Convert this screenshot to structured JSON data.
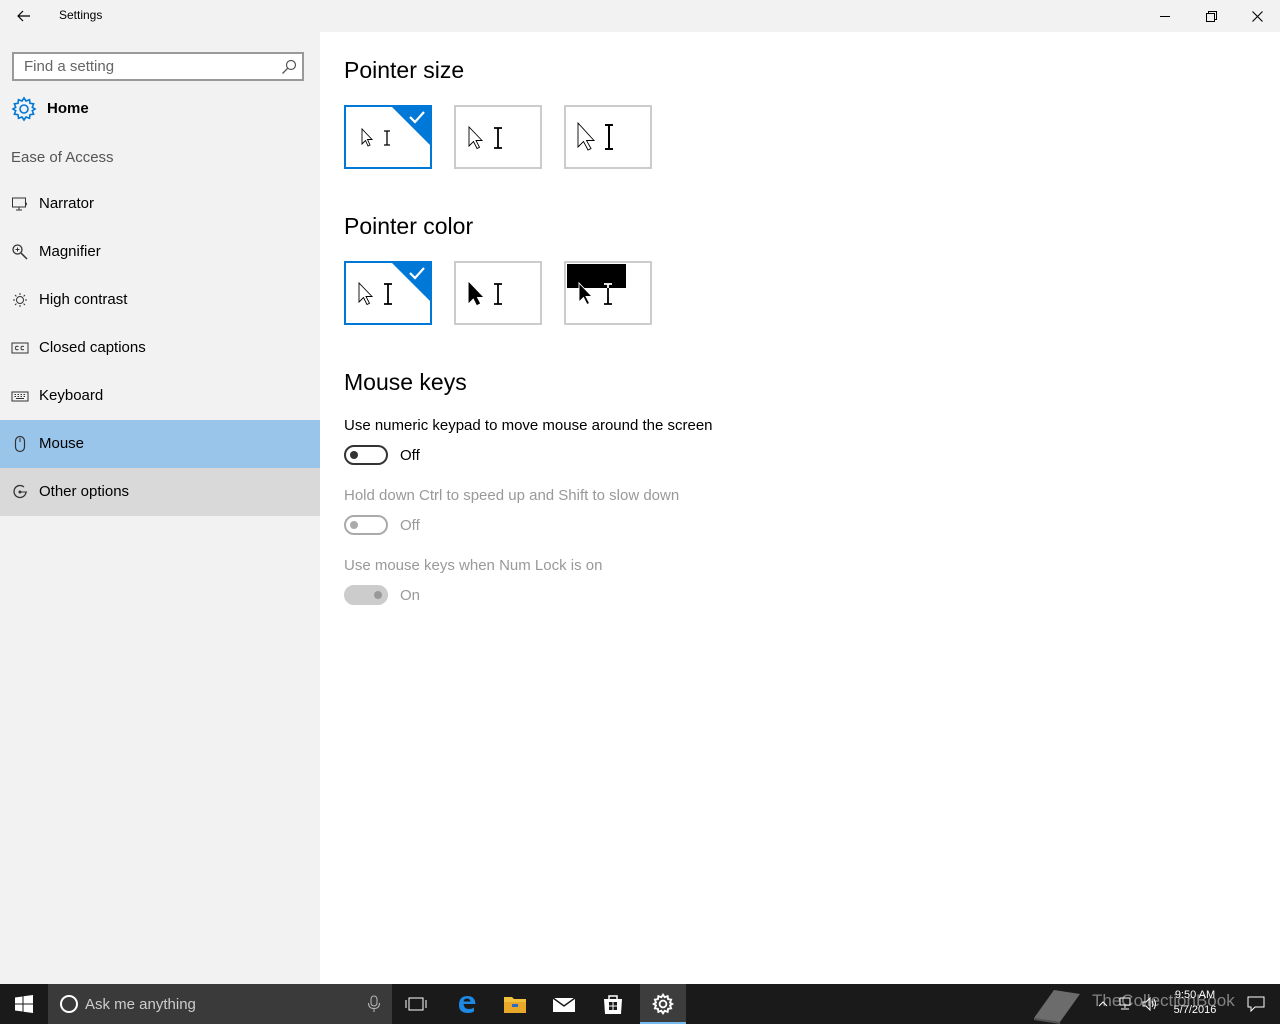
{
  "window": {
    "title": "Settings"
  },
  "sidebar": {
    "search_placeholder": "Find a setting",
    "home_label": "Home",
    "section_label": "Ease of Access",
    "items": [
      {
        "label": "Narrator",
        "icon": "narrator-icon"
      },
      {
        "label": "Magnifier",
        "icon": "magnifier-icon"
      },
      {
        "label": "High contrast",
        "icon": "high-contrast-icon"
      },
      {
        "label": "Closed captions",
        "icon": "closed-captions-icon"
      },
      {
        "label": "Keyboard",
        "icon": "keyboard-icon"
      },
      {
        "label": "Mouse",
        "icon": "mouse-icon",
        "selected": true
      },
      {
        "label": "Other options",
        "icon": "other-options-icon"
      }
    ]
  },
  "main": {
    "pointer_size": {
      "heading": "Pointer size",
      "selected_index": 0,
      "options": [
        "small",
        "medium",
        "large"
      ]
    },
    "pointer_color": {
      "heading": "Pointer color",
      "selected_index": 0,
      "options": [
        "white",
        "black",
        "inverted"
      ]
    },
    "mouse_keys": {
      "heading": "Mouse keys",
      "settings": [
        {
          "label": "Use numeric keypad to move mouse around the screen",
          "state": "Off",
          "enabled": true
        },
        {
          "label": "Hold down Ctrl to speed up and Shift to slow down",
          "state": "Off",
          "enabled": false
        },
        {
          "label": "Use mouse keys when Num Lock is on",
          "state": "On",
          "enabled": false
        }
      ]
    }
  },
  "taskbar": {
    "search_placeholder": "Ask me anything",
    "time": "9:50 AM",
    "date": "5/7/2016",
    "watermark": "TheCollectionBook"
  },
  "colors": {
    "accent": "#0078d7",
    "selected_nav": "#99c5ea",
    "sidebar_bg": "#f2f2f2",
    "taskbar_bg": "#1a1a1a"
  }
}
